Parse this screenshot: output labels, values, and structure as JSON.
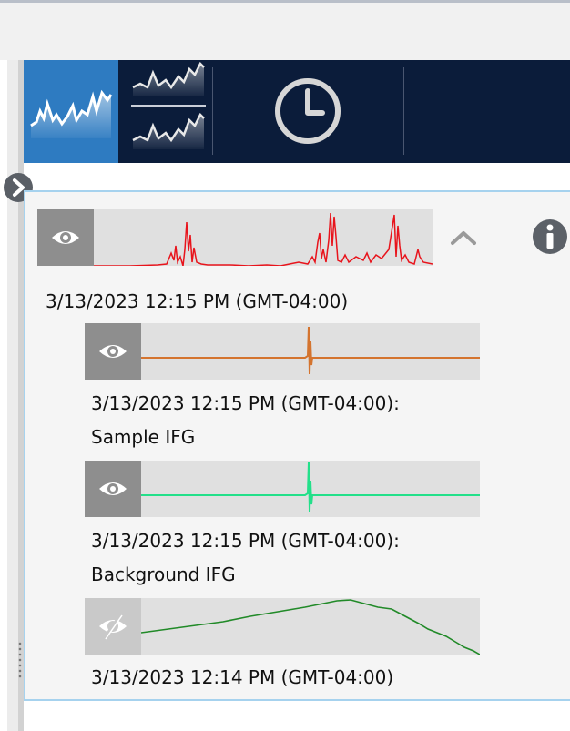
{
  "toolbar": {
    "single_plot_icon": "single-spectrum-icon",
    "dual_plot_icon": "stacked-spectra-icon",
    "history_icon": "clock-icon",
    "active_color": "#2e7bc1",
    "background_color": "#0b1c3a"
  },
  "panel": {
    "main_item": {
      "timestamp": "3/13/2023 12:15 PM (GMT-04:00)",
      "trace_color": "#e8141c",
      "visible": true
    },
    "children": [
      {
        "label_line1": "3/13/2023 12:15 PM (GMT-04:00):",
        "label_line2": "Sample IFG",
        "trace_color": "#d4742f",
        "visible": true
      },
      {
        "label_line1": "3/13/2023 12:15 PM (GMT-04:00):",
        "label_line2": "Background IFG",
        "trace_color": "#23e08a",
        "visible": true
      },
      {
        "label_line1": "3/13/2023 12:14 PM (GMT-04:00)",
        "label_line2": "",
        "trace_color": "#218a28",
        "visible": false
      }
    ]
  }
}
